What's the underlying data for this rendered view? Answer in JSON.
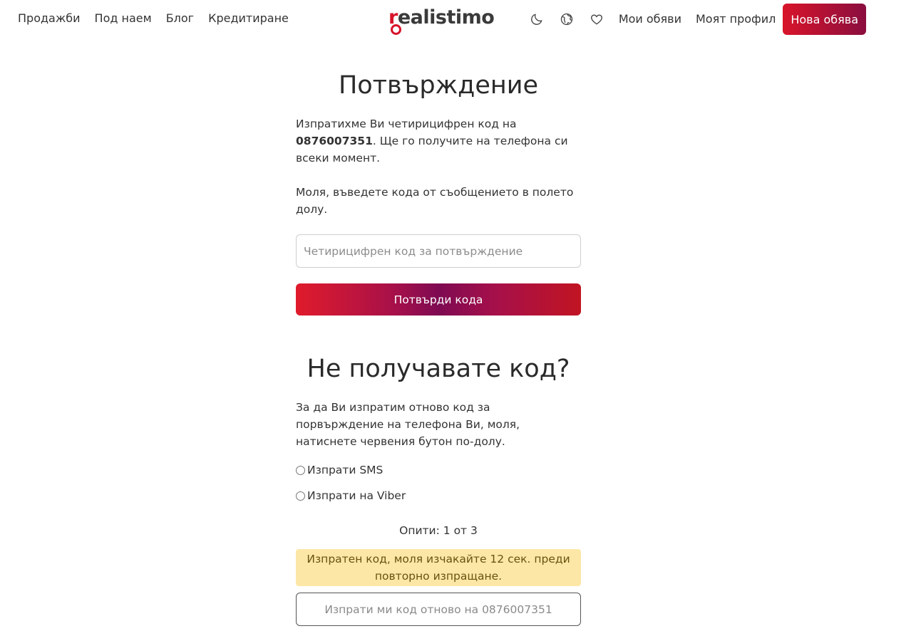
{
  "nav": {
    "left": [
      "Продажби",
      "Под наем",
      "Блог",
      "Кредитиране"
    ],
    "logo": {
      "first_letter": "r",
      "rest": "ealistimo"
    },
    "icons": [
      "moon-icon",
      "globe-icon",
      "heart-icon"
    ],
    "my_ads": "Мои обяви",
    "my_profile": "Моят профил",
    "new_ad": "Нова обява"
  },
  "confirm": {
    "title": "Потвърждение",
    "intro_before": "Изпратихме Ви четирицифрен код на",
    "phone": "0876007351",
    "intro_after": ". Ще го получите на телефона си всеки момент.",
    "instruction": "Моля, въведете кода от съобщението в полето долу.",
    "input_placeholder": "Четирицифрен код за потвърждение",
    "button": "Потвърди кода"
  },
  "resend": {
    "title": "Не получавате код?",
    "text": "За да Ви изпратим отново код за порвърждение на телефона Ви, моля, натиснете червения бутон по-долу.",
    "options": [
      "Изпрати SMS",
      "Изпрати на Viber"
    ],
    "attempts": "Опити: 1 от 3",
    "alert": "Изпратен код, моля изчакайте 12 сек. преди повторно изпращане.",
    "button": "Изпрати ми код отново на 0876007351"
  },
  "colors": {
    "brand": "#d8142a",
    "brand_dark": "#8a0e3f",
    "alert_bg": "#fde7a6"
  }
}
